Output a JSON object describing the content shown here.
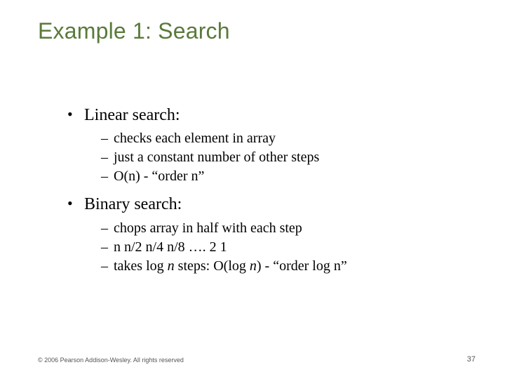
{
  "title": "Example 1: Search",
  "bullets": [
    {
      "label": "Linear search:",
      "subs": [
        "checks each element in array",
        "just a constant number of other steps",
        "O(n)  - “order n”"
      ]
    },
    {
      "label": "Binary search:",
      "subs": [
        "chops array in half with each step",
        "n   n/2   n/4   n/8  …. 2  1"
      ],
      "lastSub": {
        "prefix": "takes log ",
        "it1": "n",
        "mid": " steps: O(log ",
        "it2": "n",
        "suffix": ")  - “order log n”"
      }
    }
  ],
  "footer": {
    "copyright": "© 2006 Pearson Addison-Wesley. All rights reserved",
    "pageNumber": "37"
  }
}
